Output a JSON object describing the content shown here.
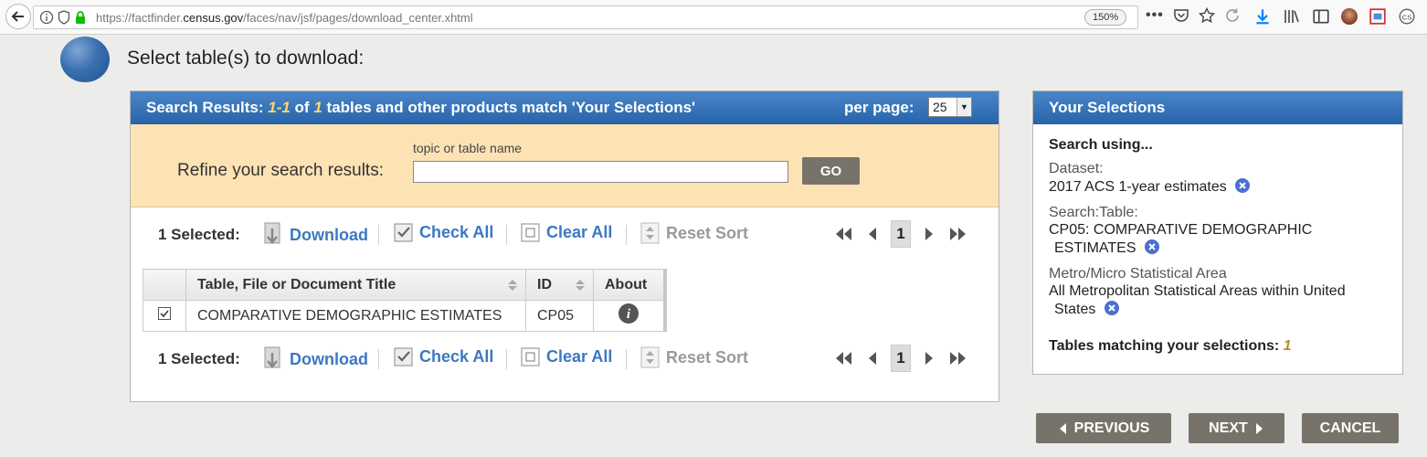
{
  "browser": {
    "url_prefix": "https://factfinder.",
    "url_domain": "census.gov",
    "url_path": "/faces/nav/jsf/pages/download_center.xhtml",
    "zoom": "150%"
  },
  "page": {
    "title": "Select table(s) to download:",
    "accent_color": "#2763a8"
  },
  "results": {
    "label": "Search Results:",
    "range": "1-1",
    "of": "of",
    "total": "1",
    "suffix": "tables and other products match 'Your Selections'",
    "per_page_label": "per page:",
    "per_page_value": "25",
    "refine_label": "Refine your search results:",
    "refine_hint": "topic or table name",
    "refine_value": "",
    "go_label": "GO",
    "selected_count": "1 Selected:",
    "download_label": "Download",
    "check_all_label": "Check All",
    "clear_all_label": "Clear All",
    "reset_sort_label": "Reset Sort",
    "page_number": "1",
    "columns": [
      "Table, File or Document Title",
      "ID",
      "About"
    ],
    "rows": [
      {
        "checked": true,
        "title": "COMPARATIVE DEMOGRAPHIC ESTIMATES",
        "id": "CP05"
      }
    ]
  },
  "selections": {
    "header": "Your Selections",
    "search_using": "Search using...",
    "dataset_label": "Dataset:",
    "dataset_value": "2017 ACS 1-year estimates",
    "table_label": "Search:Table:",
    "table_value_line1": "CP05: COMPARATIVE DEMOGRAPHIC",
    "table_value_line2": "ESTIMATES",
    "area_label": "Metro/Micro Statistical Area",
    "area_value_line1": "All Metropolitan Statistical Areas within United",
    "area_value_line2": "States",
    "matching_label": "Tables matching your selections:",
    "matching_count": "1"
  },
  "nav": {
    "previous_label": "PREVIOUS",
    "next_label": "NEXT",
    "cancel_label": "CANCEL"
  }
}
